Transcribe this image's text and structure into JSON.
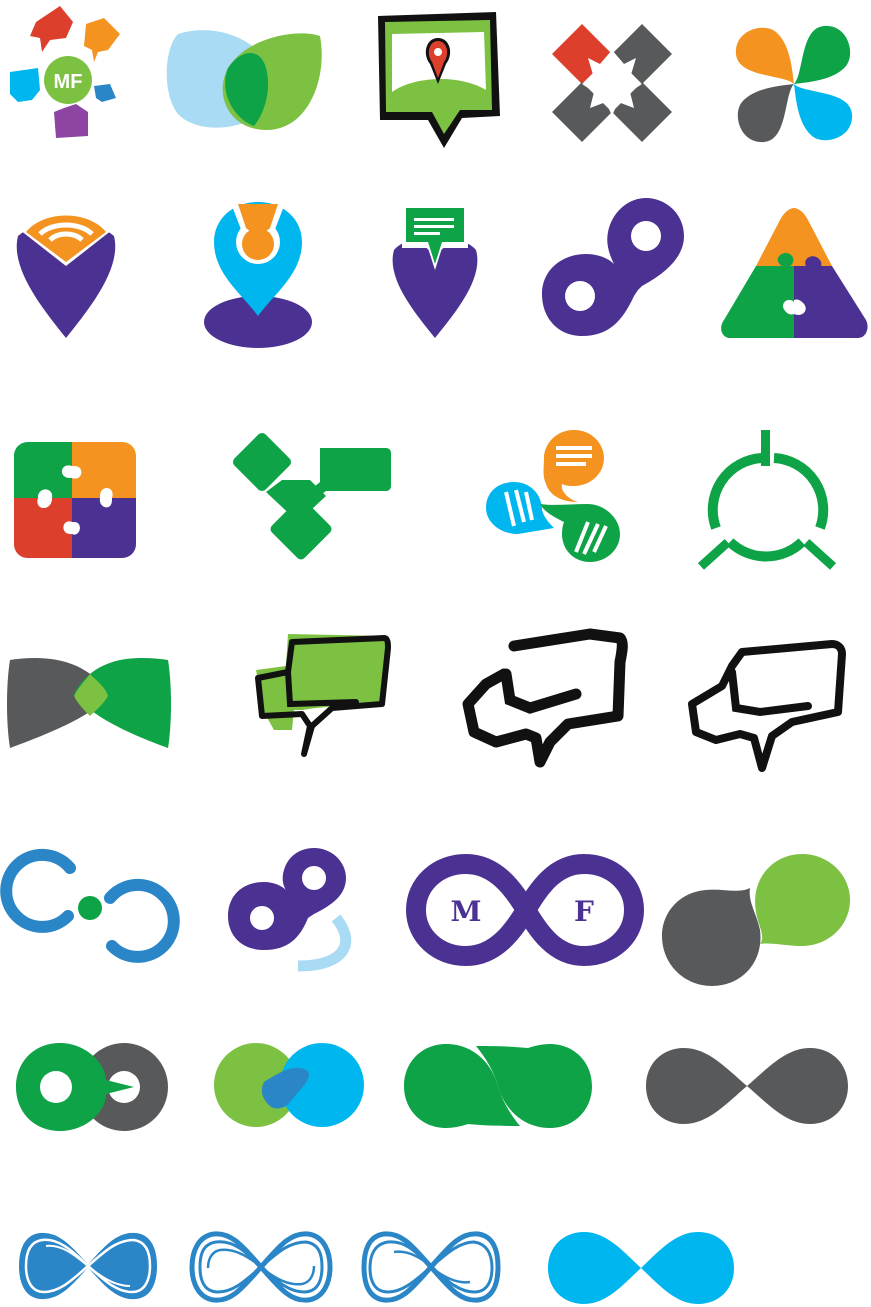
{
  "sheet": {
    "background": "#ffffff",
    "colors": {
      "purple": "#4b3192",
      "orange": "#f4931f",
      "green": "#0ea347",
      "lime": "#7dc142",
      "cyan": "#00b6ef",
      "light_blue": "#a9dbf4",
      "blue": "#2b86c7",
      "red": "#dc3f2b",
      "gray": "#58595b",
      "black": "#111111"
    }
  },
  "logos": {
    "mf_chat_cluster": {
      "monogram": "MF",
      "icon": "chat-bubbles-cluster-icon"
    },
    "overlap_blobs": {
      "icon": "overlapping-leaf-blobs-icon"
    },
    "map_chat_pin": {
      "icon": "map-pin-chat-icon"
    },
    "diamond_cross": {
      "icon": "diamond-cross-icon"
    },
    "four_petal": {
      "icon": "four-petal-pinwheel-icon"
    },
    "wifi_heart_pin": {
      "icon": "wifi-heart-pin-icon"
    },
    "location_pin": {
      "icon": "location-pin-on-oval-icon"
    },
    "message_heart_pin": {
      "icon": "message-heart-pin-icon"
    },
    "pin_links": {
      "icon": "linked-pins-icon"
    },
    "triangle_puzzle": {
      "icon": "triangle-puzzle-icon"
    },
    "square_puzzle": {
      "icon": "square-puzzle-icon"
    },
    "green_tiles": {
      "icon": "green-tiles-arrow-icon"
    },
    "chat_trio": {
      "icon": "three-chat-bubbles-icon"
    },
    "target_ring": {
      "icon": "broken-ring-target-icon"
    },
    "overlap_wings": {
      "icon": "overlap-wings-icon"
    },
    "chat_sketch_green": {
      "icon": "sketch-chat-green-icon"
    },
    "chat_sketch_rough": {
      "icon": "sketch-chat-rough-icon"
    },
    "chat_sketch_outline": {
      "icon": "sketch-chat-outline-icon"
    },
    "infinity_dot": {
      "icon": "infinity-dot-icon"
    },
    "pin_links_arc": {
      "icon": "linked-pins-arc-icon"
    },
    "mf_infinity": {
      "left_letter": "M",
      "right_letter": "F",
      "icon": "infinity-monogram-icon"
    },
    "drop_chat": {
      "icon": "drop-and-chat-icon"
    },
    "infinity_rings_green": {
      "icon": "green-gray-rings-icon"
    },
    "infinity_ribbon": {
      "icon": "green-cyan-infinity-icon"
    },
    "infinity_green_drops": {
      "icon": "green-drop-infinity-icon"
    },
    "infinity_gray": {
      "icon": "gray-infinity-icon"
    },
    "scribble_infinity_1": {
      "icon": "scribble-infinity-solid-icon"
    },
    "scribble_infinity_2": {
      "icon": "scribble-infinity-outline-icon"
    },
    "scribble_infinity_3": {
      "icon": "scribble-infinity-outline-alt-icon"
    },
    "infinity_cyan": {
      "icon": "cyan-infinity-icon"
    }
  }
}
